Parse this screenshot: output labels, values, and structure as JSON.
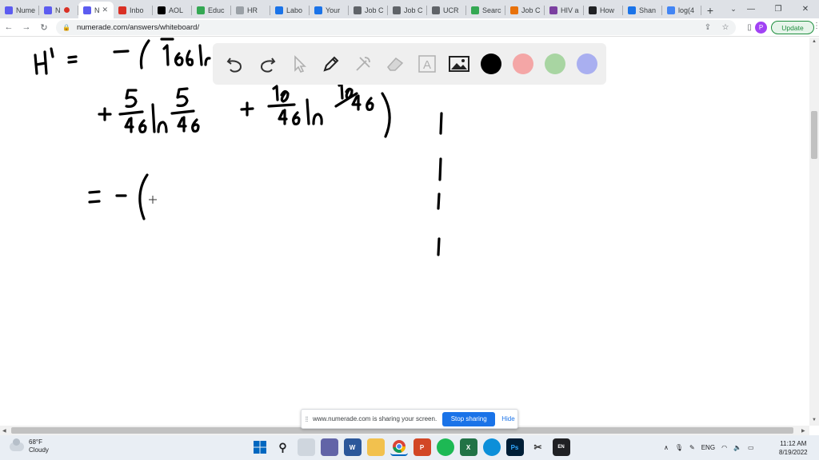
{
  "browser": {
    "tabs": [
      {
        "title": "Nume",
        "color": "#5c5cf0"
      },
      {
        "title": "N",
        "color": "#5c5cf0",
        "recording": true
      },
      {
        "title": "N",
        "color": "#5c5cf0",
        "active": true,
        "close": "✕"
      },
      {
        "title": "Inbo",
        "color": "#d93025"
      },
      {
        "title": "AOL",
        "color": "#000000"
      },
      {
        "title": "Educ",
        "color": "#34a853"
      },
      {
        "title": "HR",
        "color": "#9aa0a6"
      },
      {
        "title": "Labo",
        "color": "#1a73e8"
      },
      {
        "title": "Your",
        "color": "#1a73e8"
      },
      {
        "title": "Job C",
        "color": "#5f6368"
      },
      {
        "title": "Job C",
        "color": "#5f6368"
      },
      {
        "title": "UCR",
        "color": "#5f6368"
      },
      {
        "title": "Searc",
        "color": "#34a853"
      },
      {
        "title": "Job C",
        "color": "#e8710a"
      },
      {
        "title": "HIV a",
        "color": "#7b3fa0"
      },
      {
        "title": "How",
        "color": "#202124"
      },
      {
        "title": "Shan",
        "color": "#1a73e8"
      },
      {
        "title": "log(4",
        "color": "#4285f4"
      }
    ],
    "new_tab": "+",
    "url": "numerade.com/answers/whiteboard/",
    "update_label": "Update",
    "profile_initial": "P"
  },
  "whiteboard": {
    "tools": [
      "undo-icon",
      "redo-icon",
      "pointer-icon",
      "pen-icon",
      "tools-icon",
      "eraser-icon",
      "text-icon",
      "image-icon"
    ],
    "colors": [
      "#000000",
      "#f4a6a6",
      "#a8d5a2",
      "#a9aff0"
    ],
    "text_tool_glyph": "A"
  },
  "share": {
    "message": "www.numerade.com is sharing your screen.",
    "stop_label": "Stop sharing",
    "hide_label": "Hide"
  },
  "taskbar": {
    "weather_temp": "68°F",
    "weather_desc": "Cloudy",
    "language": "ENG",
    "time": "11:12 AM",
    "date": "8/19/2022"
  }
}
